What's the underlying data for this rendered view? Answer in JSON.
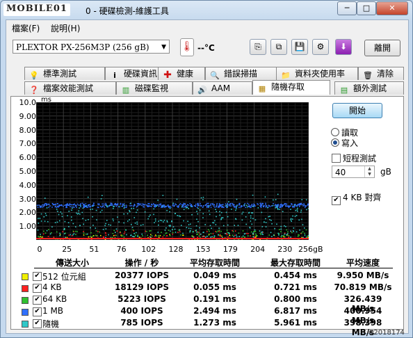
{
  "app": {
    "logo_text": "MOBILE01",
    "title": "0 - 硬碟檢測-維護工具",
    "minimize": "─",
    "maximize": "□",
    "close": "✕"
  },
  "menu": {
    "file": "檔案(F)",
    "help": "說明(H)"
  },
  "toolbar": {
    "drive": "PLEXTOR PX-256M3P (256 gB)",
    "temperature": "--°C",
    "exit_label": "離開"
  },
  "tabs_row1": [
    {
      "label": "標準測試",
      "icon": "bulb-icon"
    },
    {
      "label": "硬碟資訊",
      "icon": "info-icon"
    },
    {
      "label": "健康",
      "icon": "red-cross-icon"
    },
    {
      "label": "錯誤掃描",
      "icon": "magnifier-icon"
    },
    {
      "label": "資料夾使用率",
      "icon": "folder-icon"
    },
    {
      "label": "清除",
      "icon": "trash-icon"
    }
  ],
  "tabs_row2": [
    {
      "label": "檔案效能測試",
      "icon": "file-bench-icon"
    },
    {
      "label": "磁碟監視",
      "icon": "monitor-icon"
    },
    {
      "label": "AAM",
      "icon": "speaker-icon"
    },
    {
      "label": "隨機存取",
      "icon": "random-icon",
      "selected": true
    },
    {
      "label": "額外測試",
      "icon": "extra-icon"
    }
  ],
  "controls": {
    "start_label": "開始",
    "read_label": "讀取",
    "write_label": "寫入",
    "mode": "write",
    "short_test_label": "短程測試",
    "short_test_checked": false,
    "size_value": "40",
    "size_unit": "gB",
    "align_label": "4 KB 對齊",
    "align_checked": true
  },
  "chart_data": {
    "type": "scatter",
    "ylabel": "ms",
    "y_ticks": [
      "10.0",
      "9.00",
      "8.00",
      "7.00",
      "6.00",
      "5.00",
      "4.00",
      "3.00",
      "2.00",
      "1.00"
    ],
    "ylim": [
      0,
      10
    ],
    "x_ticks": [
      "0",
      "25",
      "51",
      "76",
      "102",
      "128",
      "153",
      "179",
      "204",
      "230",
      "256gB"
    ],
    "xlim": [
      0,
      256
    ],
    "grid": true,
    "series": [
      {
        "name": "512 位元組",
        "color": "#f0f000",
        "band": [
          0.0,
          0.45
        ]
      },
      {
        "name": "4 KB",
        "color": "#ff2020",
        "band": [
          0.0,
          0.72
        ]
      },
      {
        "name": "64 KB",
        "color": "#30c030",
        "band": [
          0.0,
          0.8
        ]
      },
      {
        "name": "1 MB",
        "color": "#3070ff",
        "band": [
          2.4,
          2.7
        ]
      },
      {
        "name": "隨機",
        "color": "#30c8c8",
        "band": [
          0.2,
          2.6
        ]
      }
    ]
  },
  "table": {
    "headers": [
      "傳送大小",
      "操作 / 秒",
      "平均存取時間",
      "最大存取時間",
      "平均速度"
    ],
    "rows": [
      {
        "size": "512 位元組",
        "ops": "20377 IOPS",
        "avg": "0.049 ms",
        "max": "0.454 ms",
        "speed": "9.950 MB/s",
        "color": "#f0f000"
      },
      {
        "size": "4 KB",
        "ops": "18129 IOPS",
        "avg": "0.055 ms",
        "max": "0.721 ms",
        "speed": "70.819 MB/s",
        "color": "#ff2020"
      },
      {
        "size": "64 KB",
        "ops": "5223 IOPS",
        "avg": "0.191 ms",
        "max": "0.800 ms",
        "speed": "326.439 MB/s",
        "color": "#30c030"
      },
      {
        "size": "1 MB",
        "ops": "400 IOPS",
        "avg": "2.494 ms",
        "max": "6.817 ms",
        "speed": "400.954 MB/s",
        "color": "#3070ff"
      },
      {
        "size": "隨機",
        "ops": "785 IOPS",
        "avg": "1.273 ms",
        "max": "5.961 ms",
        "speed": "398.398 MB/s",
        "color": "#30c8c8"
      }
    ]
  },
  "watermark": "#2018174"
}
